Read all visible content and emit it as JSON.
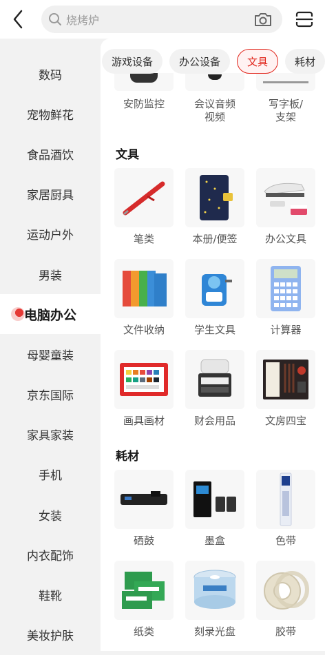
{
  "search": {
    "placeholder": "烧烤炉"
  },
  "sidebar": {
    "items": [
      {
        "label": "数码"
      },
      {
        "label": "宠物鲜花"
      },
      {
        "label": "食品酒饮"
      },
      {
        "label": "家居厨具"
      },
      {
        "label": "运动户外"
      },
      {
        "label": "男装"
      },
      {
        "label": "电脑办公",
        "active": true
      },
      {
        "label": "母婴童装"
      },
      {
        "label": "京东国际"
      },
      {
        "label": "家具家装"
      },
      {
        "label": "手机"
      },
      {
        "label": "女装"
      },
      {
        "label": "内衣配饰"
      },
      {
        "label": "鞋靴"
      },
      {
        "label": "美妆护肤"
      }
    ]
  },
  "tabs": [
    {
      "label": "游戏设备"
    },
    {
      "label": "办公设备"
    },
    {
      "label": "文具",
      "active": true
    },
    {
      "label": "耗材"
    }
  ],
  "partial_items": [
    {
      "label": "安防监控"
    },
    {
      "label": "会议音频\n视频"
    },
    {
      "label": "写字板/\n支架"
    }
  ],
  "sections": [
    {
      "title": "文具",
      "items": [
        {
          "label": "笔类",
          "icon": "pen-icon"
        },
        {
          "label": "本册/便签",
          "icon": "notebook-icon"
        },
        {
          "label": "办公文具",
          "icon": "stapler-icon"
        },
        {
          "label": "文件收纳",
          "icon": "folders-icon"
        },
        {
          "label": "学生文具",
          "icon": "sharpener-icon"
        },
        {
          "label": "计算器",
          "icon": "calculator-icon"
        },
        {
          "label": "画具画材",
          "icon": "paint-set-icon"
        },
        {
          "label": "财会用品",
          "icon": "number-stamp-icon"
        },
        {
          "label": "文房四宝",
          "icon": "brush-set-icon"
        }
      ]
    },
    {
      "title": "耗材",
      "items": [
        {
          "label": "硒鼓",
          "icon": "toner-icon"
        },
        {
          "label": "墨盒",
          "icon": "ink-cartridge-icon"
        },
        {
          "label": "色带",
          "icon": "ribbon-icon"
        },
        {
          "label": "纸类",
          "icon": "paper-icon"
        },
        {
          "label": "刻录光盘",
          "icon": "dvd-icon"
        },
        {
          "label": "胶带",
          "icon": "tape-icon"
        }
      ]
    }
  ],
  "colors": {
    "accent": "#e1251b",
    "background": "#f2f2f2"
  }
}
